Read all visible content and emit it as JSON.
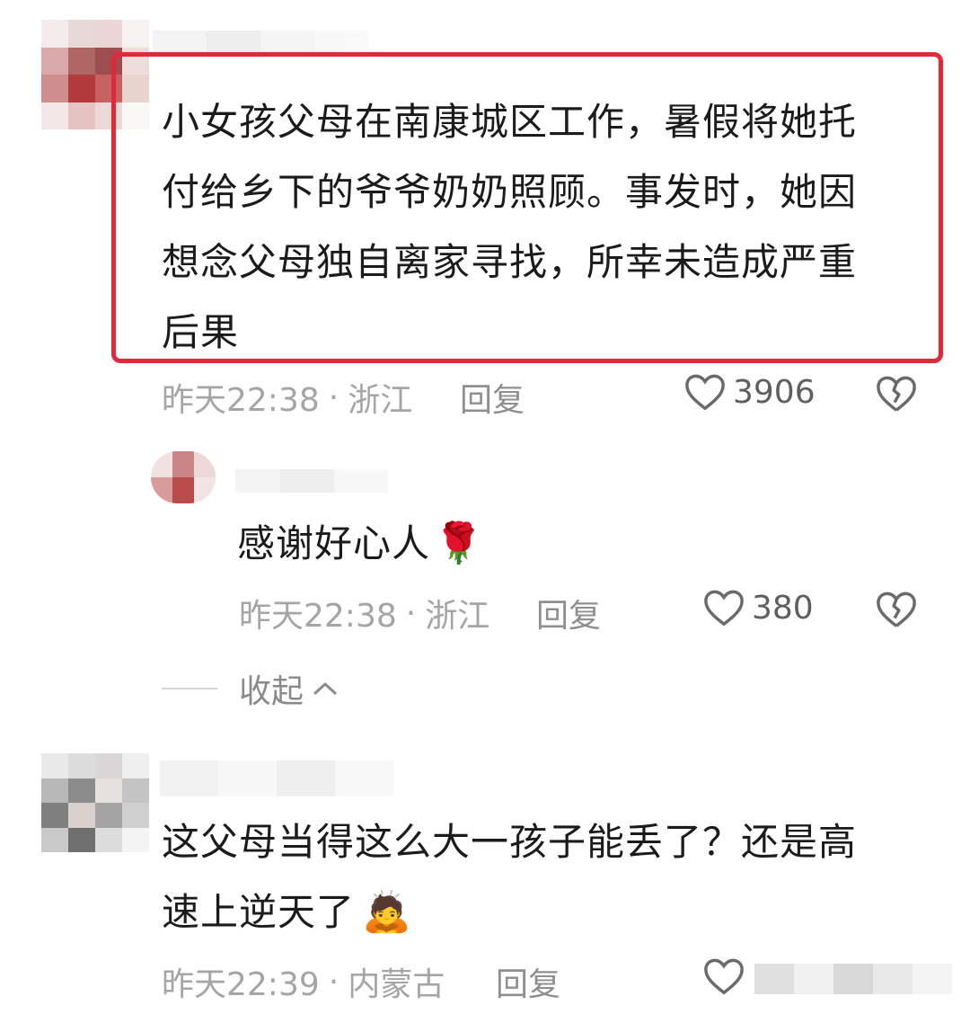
{
  "comments": [
    {
      "text": "小女孩父母在南康城区工作，暑假将她托付给乡下的爷爷奶奶照顾。事发时，她因想念父母独自离家寻找，所幸未造成严重后果",
      "lines": [
        "小女孩父母在南康城区工作，暑假将她托",
        "付给乡下的爷爷奶奶照顾。事发时，她因",
        "想念父母独自离家寻找，所幸未造成严重",
        "后果"
      ],
      "time": "昨天22:38",
      "location": "浙江",
      "reply_label": "回复",
      "likes": "3906"
    },
    {
      "text": "感谢好心人",
      "emoji": "🌹",
      "time": "昨天22:38",
      "location": "浙江",
      "reply_label": "回复",
      "likes": "380"
    },
    {
      "lines": [
        "这父母当得这么大一孩子能丢了？还是高",
        "速上逆天了"
      ],
      "emoji": "🙇",
      "time": "昨天22:39",
      "location": "内蒙古",
      "reply_label": "回复"
    }
  ],
  "thread": {
    "collapse_label": "收起"
  },
  "colors": {
    "highlight_border": "#e02a3a",
    "meta_text": "#a5a5a5"
  },
  "icons": [
    "heart-icon",
    "broken-heart-icon",
    "chevron-up-icon",
    "rose-emoji",
    "bowing-emoji"
  ]
}
